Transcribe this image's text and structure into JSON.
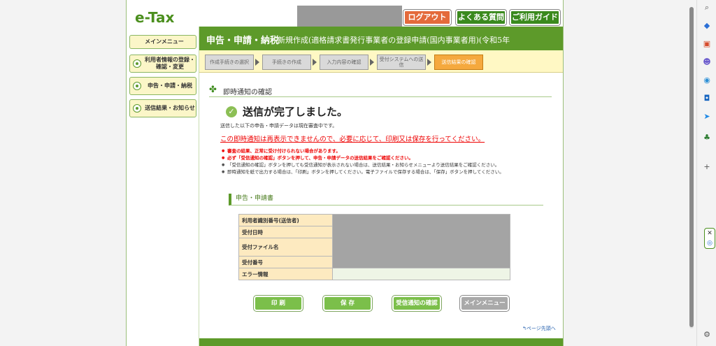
{
  "header": {
    "logo": "e-Tax",
    "logout": "ログアウト",
    "faq": "よくある質問",
    "guide": "ご利用ガイド"
  },
  "sidebar": {
    "items": [
      {
        "label": "メインメニュー"
      },
      {
        "label": "利用者情報の登録・確認・変更"
      },
      {
        "label": "申告・申請・納税"
      },
      {
        "label": "送信結果・お知らせ"
      }
    ]
  },
  "titlebar": {
    "main": "申告・申請・納税",
    "sub": "新規作成(適格請求書発行事業者の登録申請(国内事業者用)(令和5年"
  },
  "steps": [
    {
      "label": "作成手続きの選択"
    },
    {
      "label": "手続きの作成"
    },
    {
      "label": "入力内容の確認"
    },
    {
      "label": "受付システムへの送信"
    },
    {
      "label": "送信結果の確認"
    }
  ],
  "content": {
    "section_title": "即時通知の確認",
    "done_message": "送信が完了しました。",
    "under_review": "送信した以下の申告・申請データは現在審査中です。",
    "red_notice": "この即時通知は再表示できませんので、必要に応じて、印刷又は保存を行ってください。",
    "notes": [
      "審査の結果、正常に受け付けられない場合があります。",
      "必ず「受信通知の確認」ボタンを押して、申告・申請データの送信結果をご確認ください。",
      "「受信通知の確認」ボタンを押しても受信通知が表示されない場合は、送信結果・お知らせメニューより送信結果をご確認ください。",
      "即時通知を紙で出力する場合は、「印刷」ボタンを押してください。電子ファイルで保存する場合は、「保存」ボタンを押してください。"
    ],
    "sub_title": "申告・申請書",
    "table": [
      {
        "label": "利用者識別番号(送信者)"
      },
      {
        "label": "受付日時"
      },
      {
        "label": "受付ファイル名"
      },
      {
        "label": "受付番号"
      },
      {
        "label": "エラー情報"
      }
    ],
    "buttons": {
      "print": "印 刷",
      "save": "保 存",
      "receipt": "受信通知の確認",
      "main_menu": "メインメニュー"
    },
    "page_top": "ページ先頭へ"
  },
  "colors": {
    "brand_green": "#5d9a2a",
    "logout_orange": "#e46a3b",
    "active_step": "#f5a93e",
    "notice_red": "#e00000"
  },
  "browser_bar": {
    "icons": [
      "search-icon",
      "tag-icon",
      "toolbox-icon",
      "people-icon",
      "office-icon",
      "outlook-icon",
      "send-icon",
      "tree-icon",
      "plus-icon",
      "settings-icon"
    ]
  }
}
